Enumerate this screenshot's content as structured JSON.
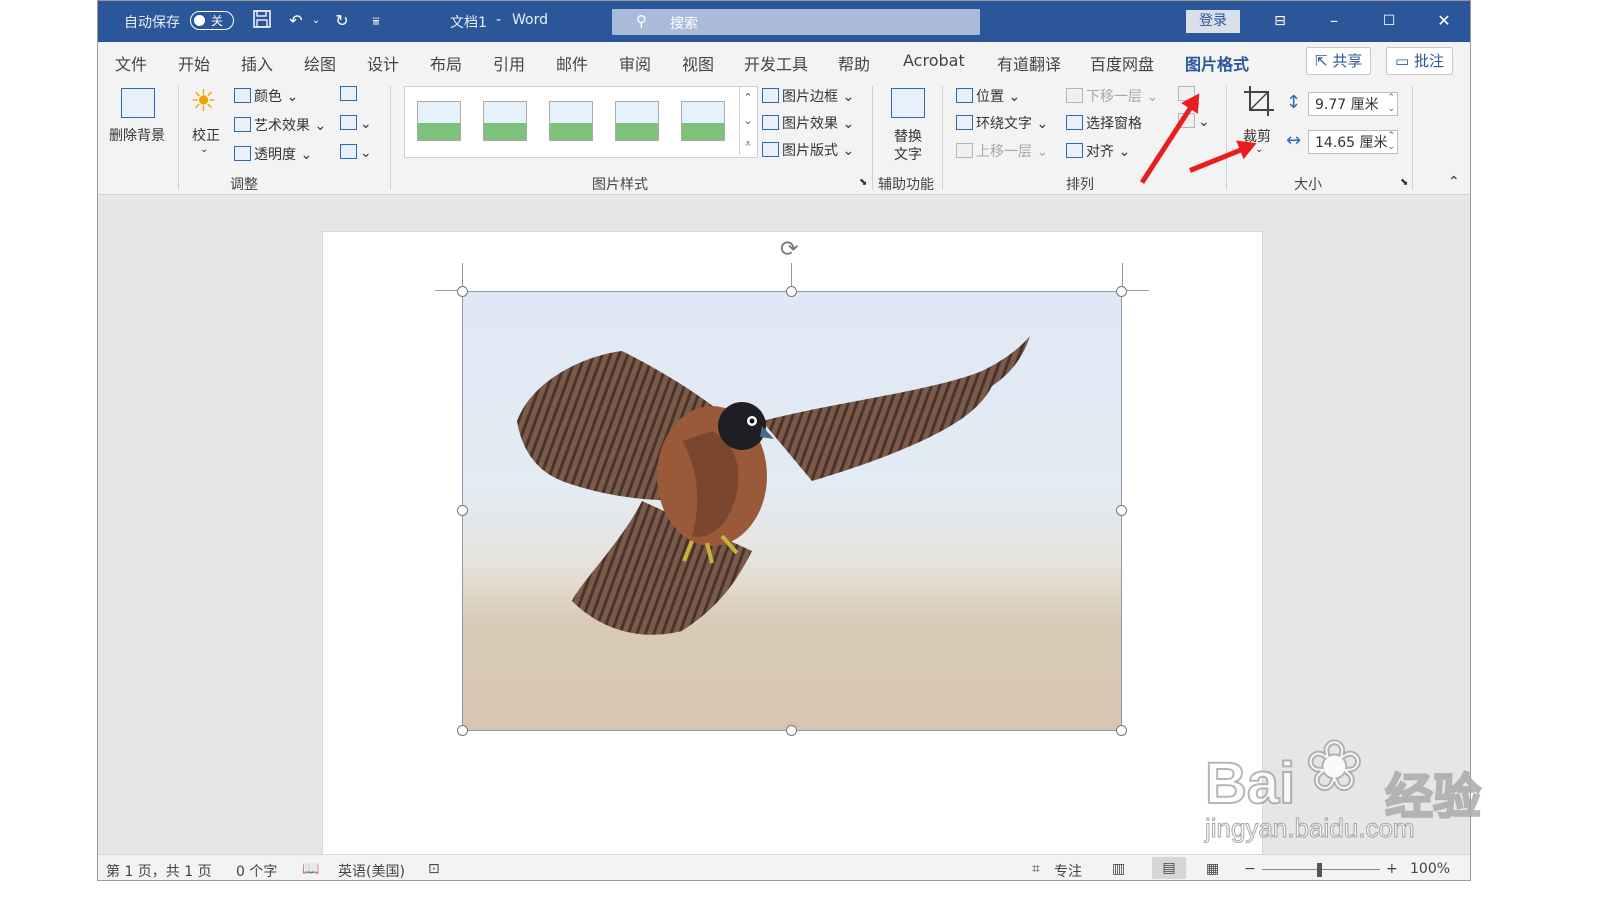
{
  "titlebar": {
    "autosave_label": "自动保存",
    "autosave_state": "关",
    "doc_title": "文档1",
    "separator": "-",
    "app_name": "Word",
    "search_placeholder": "搜索",
    "login_label": "登录",
    "icons": [
      "save-icon",
      "undo-icon",
      "redo-icon",
      "customize-icon",
      "ribbon-display-icon",
      "minimize-icon",
      "maximize-icon",
      "close-icon"
    ]
  },
  "tabs": [
    {
      "label": "文件"
    },
    {
      "label": "开始"
    },
    {
      "label": "插入"
    },
    {
      "label": "绘图"
    },
    {
      "label": "设计"
    },
    {
      "label": "布局"
    },
    {
      "label": "引用"
    },
    {
      "label": "邮件"
    },
    {
      "label": "审阅"
    },
    {
      "label": "视图"
    },
    {
      "label": "开发工具"
    },
    {
      "label": "帮助"
    },
    {
      "label": "Acrobat"
    },
    {
      "label": "有道翻译"
    },
    {
      "label": "百度网盘"
    },
    {
      "label": "图片格式",
      "active": true
    }
  ],
  "share_label": "共享",
  "comment_label": "批注",
  "ribbon": {
    "adjust": {
      "remove_bg": "删除背景",
      "correct": "校正",
      "color": "颜色",
      "art_effects": "艺术效果",
      "transparency": "透明度",
      "group_label": "调整"
    },
    "styles": {
      "border": "图片边框",
      "effects": "图片效果",
      "layout": "图片版式",
      "group_label": "图片样式"
    },
    "accessibility": {
      "alt_text_1": "替换",
      "alt_text_2": "文字",
      "group_label": "辅助功能"
    },
    "arrange": {
      "position": "位置",
      "wrap": "环绕文字",
      "bring_forward": "上移一层",
      "send_backward": "下移一层",
      "selection_pane": "选择窗格",
      "align": "对齐",
      "group_label": "排列"
    },
    "size": {
      "crop": "裁剪",
      "height": "9.77 厘米",
      "width": "14.65 厘米",
      "group_label": "大小"
    }
  },
  "status": {
    "page": "第 1 页，共 1 页",
    "words": "0 个字",
    "language": "英语(美国)",
    "focus": "专注",
    "zoom": "100%",
    "zoom_minus": "−",
    "zoom_plus": "+"
  },
  "watermark": {
    "brand": "Bai",
    "brand2": "经验",
    "url": "jingyan.baidu.com"
  },
  "colors": {
    "titlebar": "#2b579a",
    "accent": "#2b579a",
    "annotation_arrow": "#e81d1d"
  }
}
